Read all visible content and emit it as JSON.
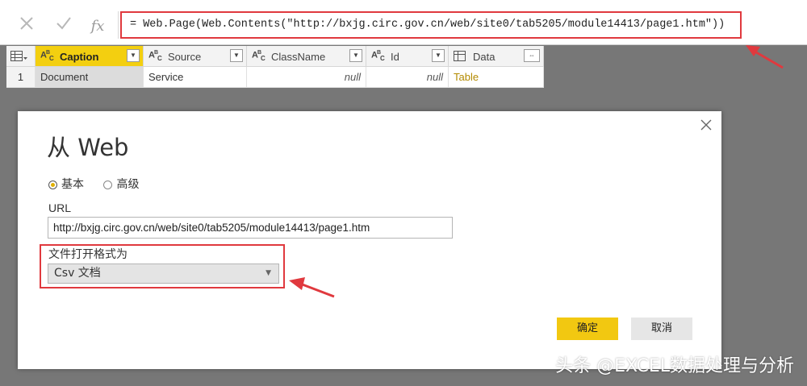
{
  "formula_bar": {
    "cancel_icon": "close-icon",
    "commit_icon": "check-icon",
    "fx_label": "fx",
    "formula": "= Web.Page(Web.Contents(\"http://bxjg.circ.gov.cn/web/site0/tab5205/module14413/page1.htm\"))"
  },
  "grid": {
    "columns": [
      {
        "type": "ABC",
        "name": "Caption"
      },
      {
        "type": "ABC",
        "name": "Source"
      },
      {
        "type": "ABC",
        "name": "ClassName"
      },
      {
        "type": "ABC",
        "name": "Id"
      },
      {
        "type": "table",
        "name": "Data"
      }
    ],
    "rows": [
      {
        "num": "1",
        "cells": [
          "Document",
          "Service",
          "null",
          "null",
          "Table"
        ]
      }
    ]
  },
  "dialog": {
    "title": "从 Web",
    "radio_basic": "基本",
    "radio_advanced": "高级",
    "url_label": "URL",
    "url_value": "http://bxjg.circ.gov.cn/web/site0/tab5205/module14413/page1.htm",
    "format_label": "文件打开格式为",
    "format_value": "Csv 文档",
    "ok_label": "确定",
    "cancel_label": "取消"
  },
  "watermark": "头条 @EXCEL数据处理与分析",
  "colors": {
    "accent": "#f2c811",
    "highlight": "#e0393e",
    "background": "#777777"
  }
}
